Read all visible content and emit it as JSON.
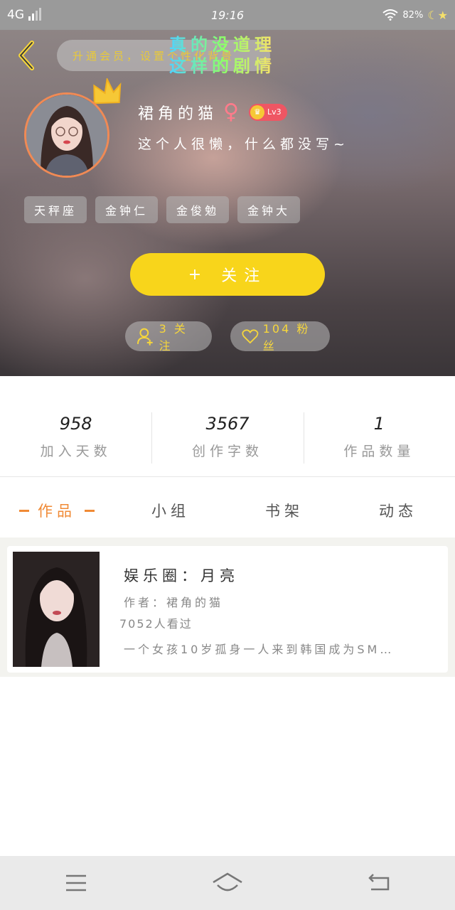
{
  "status": {
    "network": "4G",
    "time": "19:16",
    "battery": "82%"
  },
  "header": {
    "banner_text": "升通会员，设置个性化背景",
    "deco_line1": "真的没道理",
    "deco_line2": "这样的剧情",
    "nickname": "裙角的猫",
    "gender_symbol": "♀",
    "level": "Lv3",
    "signature": "这个人很懒，什么都没写~",
    "tags": [
      "天秤座",
      "金钟仁",
      "金俊勉",
      "金钟大"
    ],
    "follow_button": "关注",
    "follow_plus": "+",
    "following_label": "3 关注",
    "fans_label": "104 粉丝"
  },
  "stats": [
    {
      "value": "958",
      "label": "加入天数"
    },
    {
      "value": "3567",
      "label": "创作字数"
    },
    {
      "value": "1",
      "label": "作品数量"
    }
  ],
  "tabs": [
    {
      "label": "作品",
      "active": true
    },
    {
      "label": "小组",
      "active": false
    },
    {
      "label": "书架",
      "active": false
    },
    {
      "label": "动态",
      "active": false
    }
  ],
  "works": [
    {
      "title": "娱乐圈：月亮",
      "author": "作者：裙角的猫",
      "views": "7052人看过",
      "description": "一个女孩10岁孤身一人来到韩国成为SM…"
    }
  ],
  "colors": {
    "accent_yellow": "#f8d51b",
    "accent_orange": "#f08a35",
    "level_red": "#ef5663"
  }
}
